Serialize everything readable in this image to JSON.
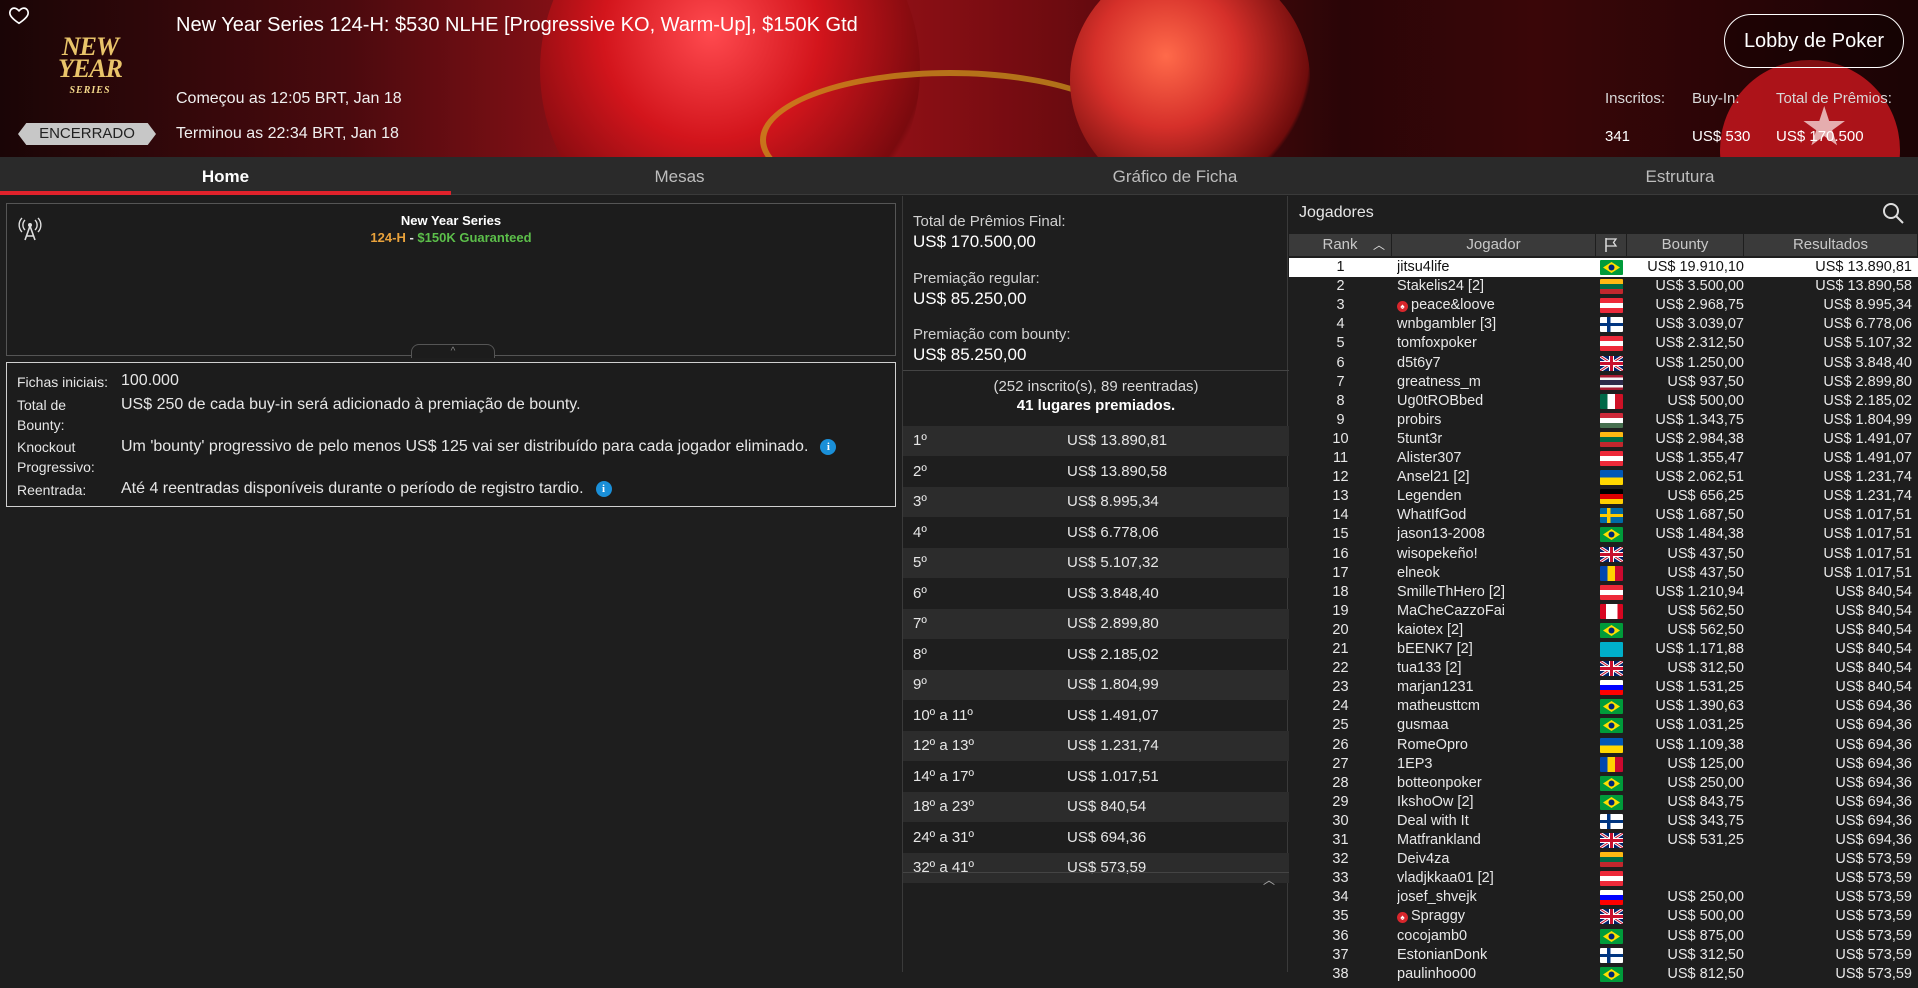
{
  "header": {
    "title": "New Year Series 124-H: $530 NLHE [Progressive KO, Warm-Up], $150K Gtd",
    "logo_line1": "NEW YEAR",
    "logo_line2": "SERIES",
    "status": "ENCERRADO",
    "started": "Começou as 12:05 BRT, Jan 18",
    "ended": "Terminou as 22:34 BRT, Jan 18",
    "lobby_button": "Lobby de Poker",
    "stats": {
      "entrants_label": "Inscritos:",
      "entrants_value": "341",
      "buyin_label": "Buy-In:",
      "buyin_value": "US$ 530",
      "prize_label": "Total de Prêmios:",
      "prize_value": "US$ 170.500"
    }
  },
  "tabs": [
    "Home",
    "Mesas",
    "Gráfico de Ficha",
    "Estrutura"
  ],
  "info": {
    "series": "New Year Series",
    "event": "124-H",
    "separator": " - ",
    "guarantee": "$150K Guaranteed",
    "collapse": "^"
  },
  "details": [
    {
      "label": "Fichas iniciais:",
      "value": "100.000",
      "info": false
    },
    {
      "label": "Total de Bounty:",
      "value": "US$ 250 de cada buy-in será adicionado à premiação de bounty.",
      "info": false
    },
    {
      "label": "Knockout Progressivo:",
      "value": "Um 'bounty' progressivo de pelo menos US$ 125 vai ser distribuído para cada jogador eliminado.",
      "info": true
    },
    {
      "label": "Reentrada:",
      "value": "Até 4 reentradas disponíveis durante o período de registro tardio.",
      "info": true
    }
  ],
  "prizes": {
    "total_label": "Total de Prêmios Final:",
    "total_value": "US$ 170.500,00",
    "regular_label": "Premiação regular:",
    "regular_value": "US$ 85.250,00",
    "bounty_label": "Premiação com bounty:",
    "bounty_value": "US$ 85.250,00",
    "entrants_text": "(252 inscrito(s), 89 reentradas)",
    "places_text": "41 lugares premiados.",
    "table": [
      {
        "pos": "1º",
        "amt": "US$ 13.890,81"
      },
      {
        "pos": "2º",
        "amt": "US$ 13.890,58"
      },
      {
        "pos": "3º",
        "amt": "US$ 8.995,34"
      },
      {
        "pos": "4º",
        "amt": "US$ 6.778,06"
      },
      {
        "pos": "5º",
        "amt": "US$ 5.107,32"
      },
      {
        "pos": "6º",
        "amt": "US$ 3.848,40"
      },
      {
        "pos": "7º",
        "amt": "US$ 2.899,80"
      },
      {
        "pos": "8º",
        "amt": "US$ 2.185,02"
      },
      {
        "pos": "9º",
        "amt": "US$ 1.804,99"
      },
      {
        "pos": "10º a 11º",
        "amt": "US$ 1.491,07"
      },
      {
        "pos": "12º a 13º",
        "amt": "US$ 1.231,74"
      },
      {
        "pos": "14º a 17º",
        "amt": "US$ 1.017,51"
      },
      {
        "pos": "18º a 23º",
        "amt": "US$ 840,54"
      },
      {
        "pos": "24º a 31º",
        "amt": "US$ 694,36"
      },
      {
        "pos": "32º a 41º",
        "amt": "US$ 573,59"
      }
    ]
  },
  "players": {
    "title": "Jogadores",
    "columns": {
      "rank": "Rank",
      "player": "Jogador",
      "bounty": "Bounty",
      "results": "Resultados"
    },
    "rows": [
      {
        "rank": "1",
        "name": "jitsu4life",
        "flag": "br",
        "bounty": "US$ 19.910,10",
        "result": "US$ 13.890,81",
        "pro": false
      },
      {
        "rank": "2",
        "name": "Stakelis24 [2]",
        "flag": "lt",
        "bounty": "US$ 3.500,00",
        "result": "US$ 13.890,58",
        "pro": false
      },
      {
        "rank": "3",
        "name": "peace&loove",
        "flag": "at",
        "bounty": "US$ 2.968,75",
        "result": "US$ 8.995,34",
        "pro": true
      },
      {
        "rank": "4",
        "name": "wnbgambler [3]",
        "flag": "fi",
        "bounty": "US$ 3.039,07",
        "result": "US$ 6.778,06",
        "pro": false
      },
      {
        "rank": "5",
        "name": "tomfoxpoker",
        "flag": "at",
        "bounty": "US$ 2.312,50",
        "result": "US$ 5.107,32",
        "pro": false
      },
      {
        "rank": "6",
        "name": "d5t6y7",
        "flag": "gb",
        "bounty": "US$ 1.250,00",
        "result": "US$ 3.848,40",
        "pro": false
      },
      {
        "rank": "7",
        "name": "greatness_m",
        "flag": "th",
        "bounty": "US$ 937,50",
        "result": "US$ 2.899,80",
        "pro": false
      },
      {
        "rank": "8",
        "name": "Ug0tROBbed",
        "flag": "mx",
        "bounty": "US$ 500,00",
        "result": "US$ 2.185,02",
        "pro": false
      },
      {
        "rank": "9",
        "name": "probirs",
        "flag": "hu",
        "bounty": "US$ 1.343,75",
        "result": "US$ 1.804,99",
        "pro": false
      },
      {
        "rank": "10",
        "name": "5tunt3r",
        "flag": "lt",
        "bounty": "US$ 2.984,38",
        "result": "US$ 1.491,07",
        "pro": false
      },
      {
        "rank": "11",
        "name": "Alister307",
        "flag": "at",
        "bounty": "US$ 1.355,47",
        "result": "US$ 1.491,07",
        "pro": false
      },
      {
        "rank": "12",
        "name": "Ansel21 [2]",
        "flag": "ua",
        "bounty": "US$ 2.062,51",
        "result": "US$ 1.231,74",
        "pro": false
      },
      {
        "rank": "13",
        "name": "Legenden",
        "flag": "de",
        "bounty": "US$ 656,25",
        "result": "US$ 1.231,74",
        "pro": false
      },
      {
        "rank": "14",
        "name": "WhatIfGod",
        "flag": "se",
        "bounty": "US$ 1.687,50",
        "result": "US$ 1.017,51",
        "pro": false
      },
      {
        "rank": "15",
        "name": "jason13-2008",
        "flag": "br",
        "bounty": "US$ 1.484,38",
        "result": "US$ 1.017,51",
        "pro": false
      },
      {
        "rank": "16",
        "name": "wisopekeño!",
        "flag": "gb",
        "bounty": "US$ 437,50",
        "result": "US$ 1.017,51",
        "pro": false
      },
      {
        "rank": "17",
        "name": "elneok",
        "flag": "md",
        "bounty": "US$ 437,50",
        "result": "US$ 1.017,51",
        "pro": false
      },
      {
        "rank": "18",
        "name": "SmilleThHero [2]",
        "flag": "at",
        "bounty": "US$ 1.210,94",
        "result": "US$ 840,54",
        "pro": false
      },
      {
        "rank": "19",
        "name": "MaCheCazzoFai",
        "flag": "ca",
        "bounty": "US$ 562,50",
        "result": "US$ 840,54",
        "pro": false
      },
      {
        "rank": "20",
        "name": "kaiotex [2]",
        "flag": "br",
        "bounty": "US$ 562,50",
        "result": "US$ 840,54",
        "pro": false
      },
      {
        "rank": "21",
        "name": "bEENK7 [2]",
        "flag": "kz",
        "bounty": "US$ 1.171,88",
        "result": "US$ 840,54",
        "pro": false
      },
      {
        "rank": "22",
        "name": "tua133 [2]",
        "flag": "gb",
        "bounty": "US$ 312,50",
        "result": "US$ 840,54",
        "pro": false
      },
      {
        "rank": "23",
        "name": "marjan1231",
        "flag": "si",
        "bounty": "US$ 1.531,25",
        "result": "US$ 840,54",
        "pro": false
      },
      {
        "rank": "24",
        "name": "matheusttcm",
        "flag": "br",
        "bounty": "US$ 1.390,63",
        "result": "US$ 694,36",
        "pro": false
      },
      {
        "rank": "25",
        "name": "gusmaa",
        "flag": "br",
        "bounty": "US$ 1.031,25",
        "result": "US$ 694,36",
        "pro": false
      },
      {
        "rank": "26",
        "name": "RomeOpro",
        "flag": "ua",
        "bounty": "US$ 1.109,38",
        "result": "US$ 694,36",
        "pro": false
      },
      {
        "rank": "27",
        "name": "1EP3",
        "flag": "md",
        "bounty": "US$ 125,00",
        "result": "US$ 694,36",
        "pro": false
      },
      {
        "rank": "28",
        "name": "botteonpoker",
        "flag": "br",
        "bounty": "US$ 250,00",
        "result": "US$ 694,36",
        "pro": false
      },
      {
        "rank": "29",
        "name": "IkshoOw [2]",
        "flag": "br",
        "bounty": "US$ 843,75",
        "result": "US$ 694,36",
        "pro": false
      },
      {
        "rank": "30",
        "name": "Deal with It",
        "flag": "fi",
        "bounty": "US$ 343,75",
        "result": "US$ 694,36",
        "pro": false
      },
      {
        "rank": "31",
        "name": "Matfrankland",
        "flag": "gb",
        "bounty": "US$ 531,25",
        "result": "US$ 694,36",
        "pro": false
      },
      {
        "rank": "32",
        "name": "Deiv4za",
        "flag": "lt",
        "bounty": "",
        "result": "US$ 573,59",
        "pro": false
      },
      {
        "rank": "33",
        "name": "vladjkkaa01 [2]",
        "flag": "at",
        "bounty": "",
        "result": "US$ 573,59",
        "pro": false
      },
      {
        "rank": "34",
        "name": "josef_shvejk",
        "flag": "si",
        "bounty": "US$ 250,00",
        "result": "US$ 573,59",
        "pro": false
      },
      {
        "rank": "35",
        "name": "Spraggy",
        "flag": "gb",
        "bounty": "US$ 500,00",
        "result": "US$ 573,59",
        "pro": true
      },
      {
        "rank": "36",
        "name": "cocojamb0",
        "flag": "br",
        "bounty": "US$ 875,00",
        "result": "US$ 573,59",
        "pro": false
      },
      {
        "rank": "37",
        "name": "EstonianDonk",
        "flag": "fi",
        "bounty": "US$ 312,50",
        "result": "US$ 573,59",
        "pro": false
      },
      {
        "rank": "38",
        "name": "paulinhoo00",
        "flag": "br",
        "bounty": "US$ 812,50",
        "result": "US$ 573,59",
        "pro": false
      }
    ]
  }
}
